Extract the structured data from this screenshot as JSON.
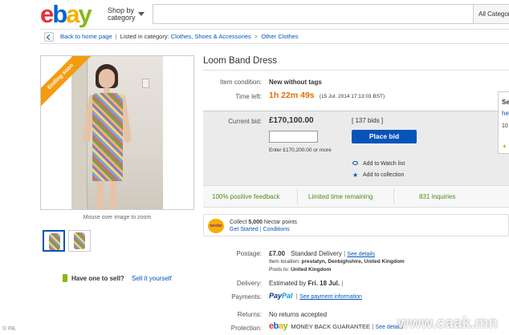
{
  "header": {
    "logo": {
      "e": "e",
      "b": "b",
      "a": "a",
      "y": "y"
    },
    "shop_by_line1": "Shop by",
    "shop_by_line2": "category",
    "search_placeholder": "",
    "all_categories": "All Categories"
  },
  "breadcrumb": {
    "back_label": "Back to home page",
    "listed_in": "Listed in category:",
    "cat1": "Clothes, Shoes & Accessories",
    "cat2": "Other Clothes"
  },
  "gallery": {
    "ribbon": "Ending soon",
    "zoom_hint": "Mouse over image to zoom",
    "sell_question": "Have one to sell?",
    "sell_link": "Sell it yourself"
  },
  "item": {
    "title": "Loom Band Dress",
    "condition_label": "Item condition:",
    "condition_value": "New without tags",
    "time_left_label": "Time left:",
    "time_left_value": "1h 22m 49s",
    "end_time": "(15 Jul. 2014  17:13:03 BST)",
    "current_bid_label": "Current bid:",
    "current_bid_value": "£170,100.00",
    "bids_count": "[ 137 bids ]",
    "bid_hint": "Enter £170,200.00 or more",
    "place_bid": "Place bid",
    "watch_list": "Add to Watch list",
    "add_collection": "Add to collection",
    "stat1": "100% positive feedback",
    "stat2": "Limited time remaining",
    "stat3": "831 inquiries"
  },
  "nectar": {
    "badge": "nectar",
    "line1_pre": "Collect ",
    "line1_points": "5,000",
    "line1_post": " Nectar points",
    "get_started": "Get Started",
    "conditions": "Conditions"
  },
  "shipping": {
    "postage_label": "Postage:",
    "postage_value": "£7.00",
    "postage_service": "Standard Delivery",
    "see_details": "See details",
    "item_location_label": "Item location:",
    "item_location_value": "prestatyn, Denbighshire, United Kingdom",
    "posts_to_label": "Posts to:",
    "posts_to_value": "United Kingdom",
    "delivery_label": "Delivery:",
    "delivery_pre": "Estimated by",
    "delivery_date": "Fri. 18 Jul.",
    "payments_label": "Payments:",
    "paypal1": "Pay",
    "paypal2": "Pal",
    "payment_info": "See payment information",
    "returns_label": "Returns:",
    "returns_value": "No returns accepted",
    "protection_label": "Protection:",
    "protection_ebay": "ebay",
    "protection_value": "MONEY BACK GUARANTEE",
    "protection_see": "See details"
  },
  "right_panel": {
    "s": "Se",
    "h": "he",
    "n": "10",
    "plus": "+"
  },
  "credits": {
    "pa": "© PA",
    "watermark": "www.caak.mn"
  },
  "colors": {
    "ebay_red": "#e53238",
    "ebay_blue": "#0064d2",
    "ebay_yellow": "#f5af02",
    "ebay_green": "#86b817",
    "link": "#0654ba",
    "time_left": "#dd6f00",
    "button": "#0654ba"
  }
}
